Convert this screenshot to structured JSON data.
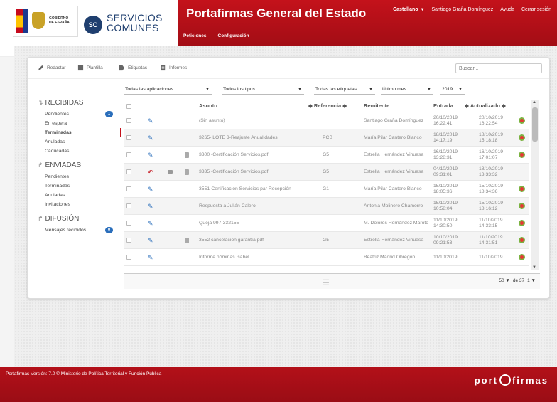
{
  "header": {
    "gov_text": [
      "GOBIERNO",
      "DE ESPAÑA"
    ],
    "sc_logo": "SC",
    "sc_text_1": "SERVICIOS",
    "sc_text_2": "COMUNES",
    "app_title": "Portafirmas General del Estado",
    "language": "Castellano",
    "user": "Santiago Graña Domínguez",
    "help": "Ayuda",
    "logout": "Cerrar sesión",
    "menu": [
      "Peticiones",
      "Configuración"
    ]
  },
  "toolbar": {
    "redactar": "Redactar",
    "plantilla": "Plantilla",
    "etiquetas": "Etiquetas",
    "informes": "Informes",
    "search_placeholder": "Buscar..."
  },
  "sidebar": {
    "recibidas": {
      "title": "RECIBIDAS",
      "items": [
        {
          "label": "Pendientes",
          "badge": "1"
        },
        {
          "label": "En espera"
        },
        {
          "label": "Terminadas",
          "active": true
        },
        {
          "label": "Anuladas"
        },
        {
          "label": "Caducadas"
        }
      ]
    },
    "enviadas": {
      "title": "ENVIADAS",
      "items": [
        {
          "label": "Pendientes"
        },
        {
          "label": "Terminadas"
        },
        {
          "label": "Anuladas"
        },
        {
          "label": "Invitaciones"
        }
      ]
    },
    "difusion": {
      "title": "DIFUSIÓN",
      "items": [
        {
          "label": "Mensajes recibidos",
          "badge": "0"
        }
      ]
    }
  },
  "filters": {
    "apps": "Todas las aplicaciones",
    "types": "Todos los tipos",
    "tags": "Todas las etiquetas",
    "period": "Último mes",
    "year": "2019"
  },
  "table": {
    "headers": {
      "asunto": "Asunto",
      "referencia": "Referencia",
      "remitente": "Remitente",
      "entrada": "Entrada",
      "actualizado": "Actualizado"
    },
    "rows": [
      {
        "asunto": "(Sin asunto)",
        "ref": "",
        "remitente": "Santiago Graña Domínguez",
        "entrada": "20/10/2019 16:22:41",
        "actualizado": "20/10/2019 16:22:54",
        "doc": false,
        "comment": false
      },
      {
        "asunto": "3265- LOTE 3-Reajuste Anualidades",
        "ref": "PCB",
        "remitente": "María Pilar Cantero Blanco",
        "entrada": "18/10/2019 14:17:19",
        "actualizado": "18/10/2019 15:18:18",
        "doc": false,
        "comment": false
      },
      {
        "asunto": "3300 -Certificación Servicios.pdf",
        "ref": "G5",
        "remitente": "Estrella Hernández Vinuesa",
        "entrada": "16/10/2019 13:28:31",
        "actualizado": "16/10/2019 17:01:07",
        "doc": true,
        "comment": false
      },
      {
        "asunto": "3335 -Certificación Servicios.pdf",
        "ref": "G5",
        "remitente": "Estrella Hernández Vinuesa",
        "entrada": "04/10/2019 09:31:01",
        "actualizado": "18/10/2019 13:33:32",
        "doc": true,
        "comment": true
      },
      {
        "asunto": "3551-Certificación Servicios par Recepción",
        "ref": "G1",
        "remitente": "María Pilar Cantero Blanco",
        "entrada": "15/10/2019 18:05:36",
        "actualizado": "15/10/2019 18:34:36",
        "doc": false,
        "comment": false
      },
      {
        "asunto": "Respuesta a Julián Calero",
        "ref": "",
        "remitente": "Antonia Molinero Chamorro",
        "entrada": "15/10/2019 10:58:04",
        "actualizado": "15/10/2019 18:16:12",
        "doc": false,
        "comment": false
      },
      {
        "asunto": "Queja 997-332155",
        "ref": "",
        "remitente": "M. Dolores Hernández Maroto",
        "entrada": "11/10/2019 14:30:50",
        "actualizado": "11/10/2019 14:33:15",
        "doc": false,
        "comment": false
      },
      {
        "asunto": "3552 cancelacion garantía.pdf",
        "ref": "G5",
        "remitente": "Estrella Hernández Vinuesa",
        "entrada": "10/10/2019 09:21:53",
        "actualizado": "11/10/2019 14:31:51",
        "doc": true,
        "comment": false
      },
      {
        "asunto": "Informe nóminas Isabel",
        "ref": "",
        "remitente": "Beatriz Madrid Obregon",
        "entrada": "11/10/2019",
        "actualizado": "11/10/2019",
        "doc": false,
        "comment": false
      }
    ],
    "page_size": "50",
    "page_of": "de 37",
    "page_current": "1"
  },
  "footer": {
    "text": "Portafirmas Versión: 7.0 © Ministerio de Política Territorial y Función Pública",
    "logo_left": "port",
    "logo_right": "firmas"
  }
}
